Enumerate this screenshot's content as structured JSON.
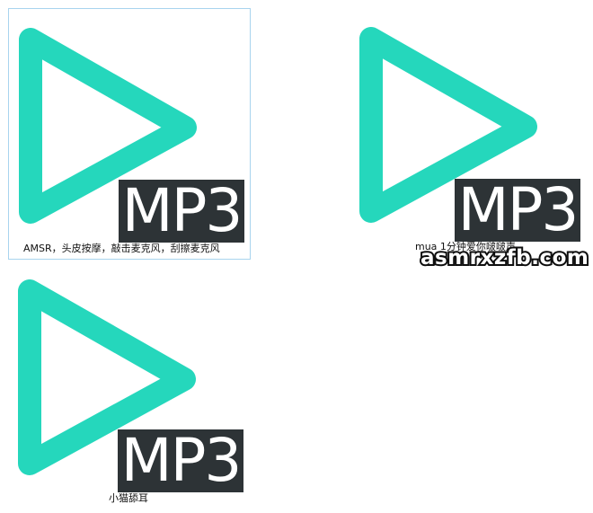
{
  "colors": {
    "play_triangle": "#25d7bc",
    "badge_background": "#2d3336",
    "badge_text": "#ffffff",
    "selection_border": "#a8d4ee"
  },
  "files": [
    {
      "icon": "play-triangle-icon",
      "badge": "MP3",
      "caption": "AMSR，头皮按摩，敲击麦克风，刮擦麦克风",
      "selected": true
    },
    {
      "icon": "play-triangle-icon",
      "badge": "MP3",
      "caption": "mua 1分钟爱你啵啵声",
      "selected": false
    },
    {
      "icon": "play-triangle-icon",
      "badge": "MP3",
      "caption": "小猫舔耳",
      "selected": false
    }
  ],
  "watermark": "asmrxzfb.com"
}
